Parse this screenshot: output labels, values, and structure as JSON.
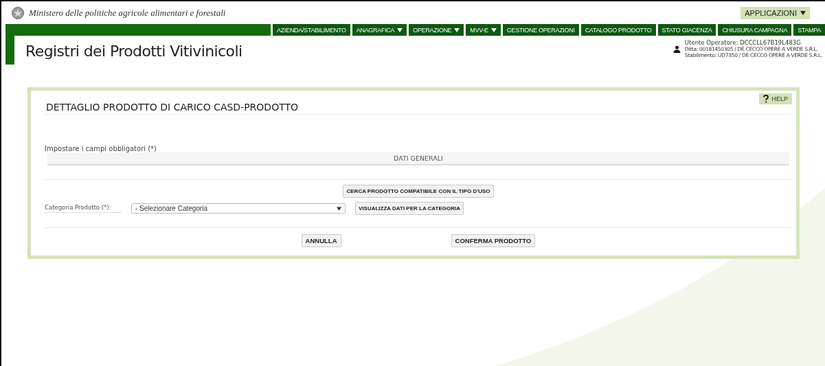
{
  "header": {
    "ministry": "Ministero delle politiche agricole alimentari e forestali",
    "apps_menu": {
      "label": "APPLICAZIONI",
      "dropdown": true
    }
  },
  "nav": [
    {
      "label": "AZIENDA/STABILIMENTO",
      "dropdown": false
    },
    {
      "label": "ANAGRAFICA",
      "dropdown": true
    },
    {
      "label": "OPERAZIONE",
      "dropdown": true
    },
    {
      "label": "MVV-E",
      "dropdown": true
    },
    {
      "label": "GESTIONE OPERAZIONI",
      "dropdown": false
    },
    {
      "label": "CATALOGO PRODOTTO",
      "dropdown": false
    },
    {
      "label": "STATO GIACENZA",
      "dropdown": false
    },
    {
      "label": "CHIUSURA CAMPAGNA",
      "dropdown": false
    },
    {
      "label": "STAMPA",
      "dropdown": false
    }
  ],
  "app_title": "Registri dei Prodotti Vitivinicoli",
  "user": {
    "operator": "Utente Operatore: DCCCLL67B19L483G",
    "company": "Ditta: 00181450305 / DE CECCO OPERE A VERDE S.R.L.",
    "plant": "Stabilimento: UD7350 / DE CECCO OPERE A VERDE S.R.L."
  },
  "panel": {
    "title": "DETTAGLIO PRODOTTO DI CARICO CASD-PRODOTTO",
    "help": "HELP",
    "required_note": "Impostare i campi obbligatori (*)",
    "section": "DATI GENERALI",
    "search_button": "CERCA PRODOTTO COMPATIBILE CON IL TIPO D'USO",
    "category_label": "Categoria Prodotto (*):",
    "category_value": "- Selezionare Categoria",
    "show_button": "VISUALIZZA DATI PER LA CATEGORIA",
    "buttons": [
      "ANNULLA",
      "CONFERMA PRODOTTO"
    ]
  }
}
